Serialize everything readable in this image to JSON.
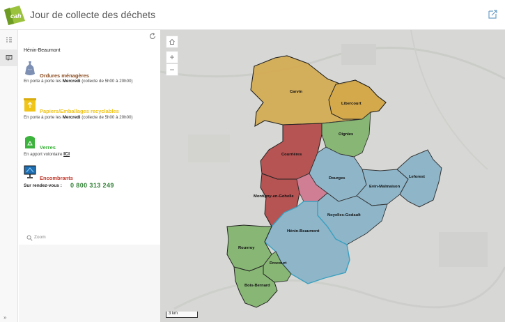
{
  "header": {
    "title": "Jour de collecte des déchets",
    "logo_text": "cah"
  },
  "sidebar": {
    "commune": "Hénin-Beaumont"
  },
  "sections": {
    "om": {
      "title": "Ordures ménagères",
      "color": "#8a4a1c",
      "text_pre": "En porte à porte les ",
      "day": "Mercredi",
      "text_post": " (collecte de 5h00 à 20h00)"
    },
    "pe": {
      "title": "Papiers/Emballages recyclables",
      "color": "#f0c419",
      "text_pre": "En porte à porte les ",
      "day": "Mercredi",
      "text_post": " (collecte de 5h00 à 20h00)"
    },
    "verres": {
      "title": "Verres",
      "color": "#3cb33c",
      "text_pre": "En apport volontaire ",
      "link": "ICI"
    },
    "enc": {
      "title": "Encombrants",
      "color": "#c0392b",
      "phone_label": "Sur rendez-vous :",
      "phone": "0 800 313 249"
    }
  },
  "zoom": {
    "label": "Zoom"
  },
  "map": {
    "scale_label": "3 km",
    "towns": {
      "carvin": "Carvin",
      "libercourt": "Libercourt",
      "oignies": "Oignies",
      "courrieres": "Courrières",
      "dourges": "Dourges",
      "evin": "Evin-Malmaison",
      "leforest": "Leforest",
      "montigny": "Montigny-en-Gohelle",
      "noyelles": "Noyelles-Godault",
      "henin": "Hénin-Beaumont",
      "rouvroy": "Rouvroy",
      "drocourt": "Drocourt",
      "bois": "Bois-Bernard"
    }
  }
}
